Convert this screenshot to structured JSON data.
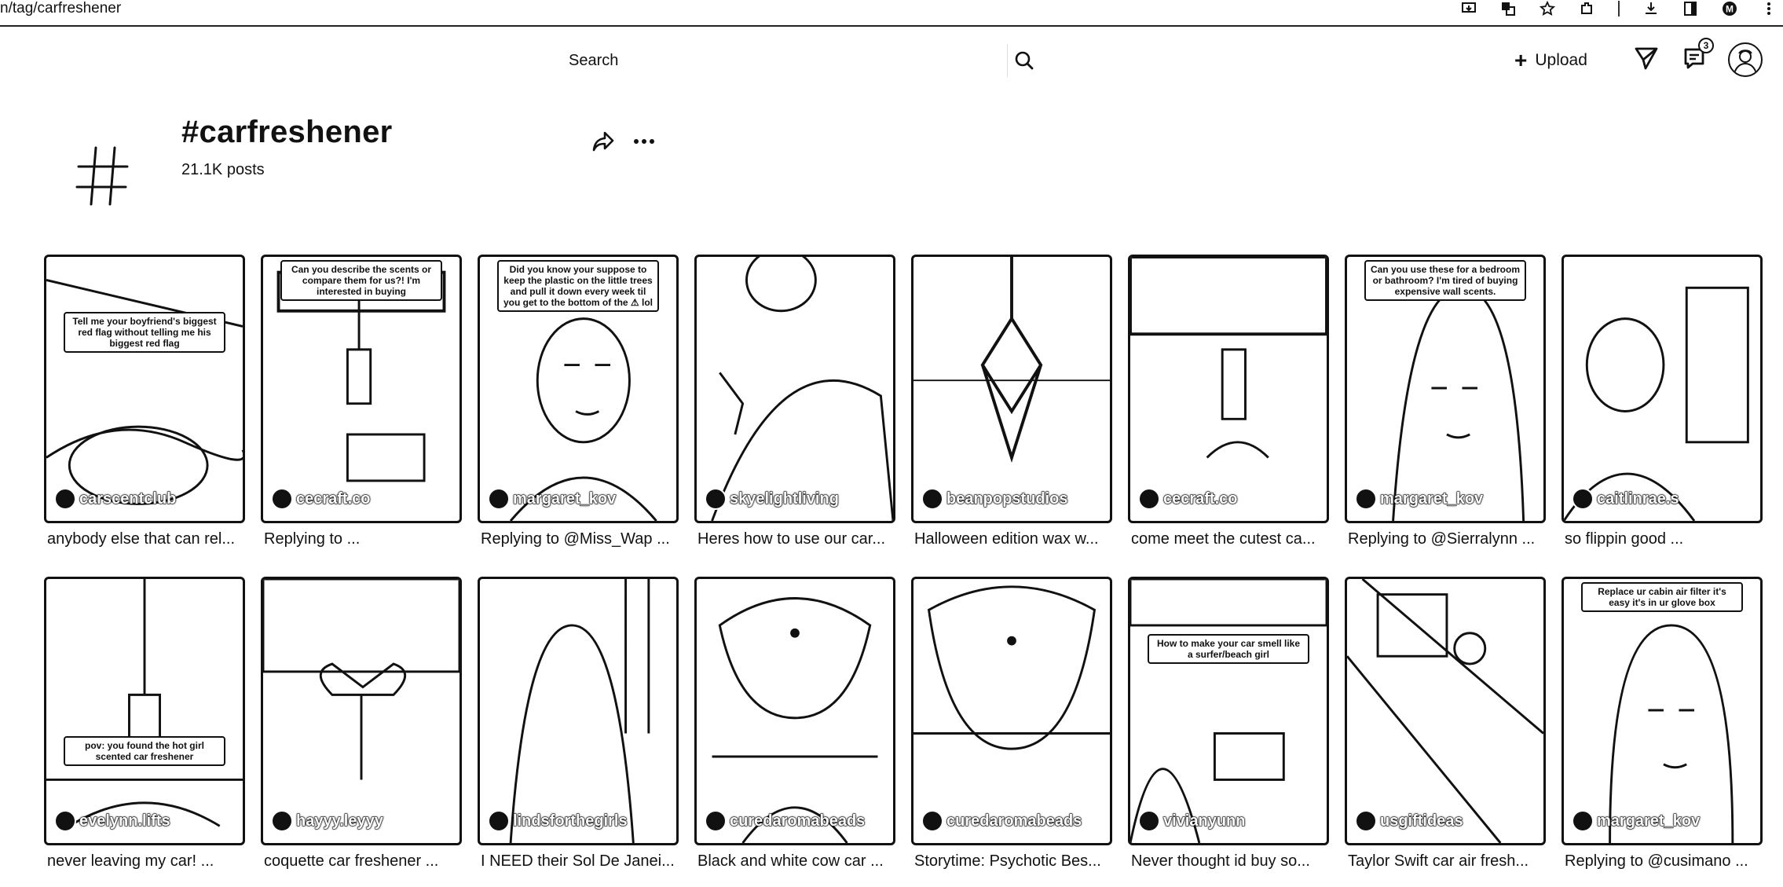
{
  "browser": {
    "url": "n/tag/carfreshener",
    "icons": [
      "install-icon",
      "translate-icon",
      "star-icon",
      "extensions-icon",
      "download-icon",
      "sidepanel-icon",
      "profile-icon",
      "kebab-icon"
    ]
  },
  "nav": {
    "search_placeholder": "Search",
    "upload_label": "Upload",
    "upload_plus": "+",
    "inbox_badge": "3"
  },
  "tag": {
    "title": "#carfreshener",
    "posts": "21.1K posts"
  },
  "videos": [
    {
      "creator": "carscentclub",
      "desc": "anybody else that can rel...",
      "overlay": "Tell me your boyfriend's biggest red flag without telling me his biggest red flag",
      "overlay_pos": "mid"
    },
    {
      "creator": "cecraft.co",
      "desc": "Replying to ...",
      "overlay": "Can you describe the scents or compare them for us?! I'm interested in buying",
      "overlay_pos": "top"
    },
    {
      "creator": "margaret_kov",
      "desc": "Replying to @Miss_Wap ...",
      "overlay": "Did you know your suppose to keep the plastic on the little trees and pull it down every week til you get to the bottom of the ⚠ lol",
      "overlay_pos": "top"
    },
    {
      "creator": "skyelightliving",
      "desc": "Heres how to use our car...",
      "overlay": "",
      "overlay_pos": ""
    },
    {
      "creator": "beanpopstudios",
      "desc": "Halloween edition wax w...",
      "overlay": "",
      "overlay_pos": ""
    },
    {
      "creator": "cecraft.co",
      "desc": "come meet the cutest ca...",
      "overlay": "",
      "overlay_pos": ""
    },
    {
      "creator": "margaret_kov",
      "desc": "Replying to @Sierralynn ...",
      "overlay": "Can you use these for a bedroom or bathroom? I'm tired of buying expensive wall scents.",
      "overlay_pos": "top"
    },
    {
      "creator": "caitlinrae.s",
      "desc": "so flippin good ...",
      "overlay": "",
      "overlay_pos": ""
    },
    {
      "creator": "evelynn.lifts",
      "desc": "never leaving my car! ...",
      "overlay": "pov: you found the hot girl scented car freshener",
      "overlay_pos": "low"
    },
    {
      "creator": "hayyy.leyyy",
      "desc": "coquette car freshener ...",
      "overlay": "",
      "overlay_pos": ""
    },
    {
      "creator": "lindsforthegirls",
      "desc": "I NEED their Sol De Janei...",
      "overlay": "",
      "overlay_pos": ""
    },
    {
      "creator": "curedaromabeads",
      "desc": "Black and white cow car ...",
      "overlay": "",
      "overlay_pos": ""
    },
    {
      "creator": "curedaromabeads",
      "desc": "Storytime: Psychotic Bes...",
      "overlay": "",
      "overlay_pos": ""
    },
    {
      "creator": "vivianyunn",
      "desc": "Never thought id buy so...",
      "overlay": "How to make your car smell like a surfer/beach girl",
      "overlay_pos": "upper"
    },
    {
      "creator": "usgiftideas",
      "desc": "Taylor Swift car air fresh...",
      "overlay": "",
      "overlay_pos": ""
    },
    {
      "creator": "margaret_kov",
      "desc": "Replying to @cusimano ...",
      "overlay": "Replace ur cabin air filter it's easy it's in ur glove box",
      "overlay_pos": "top"
    }
  ]
}
